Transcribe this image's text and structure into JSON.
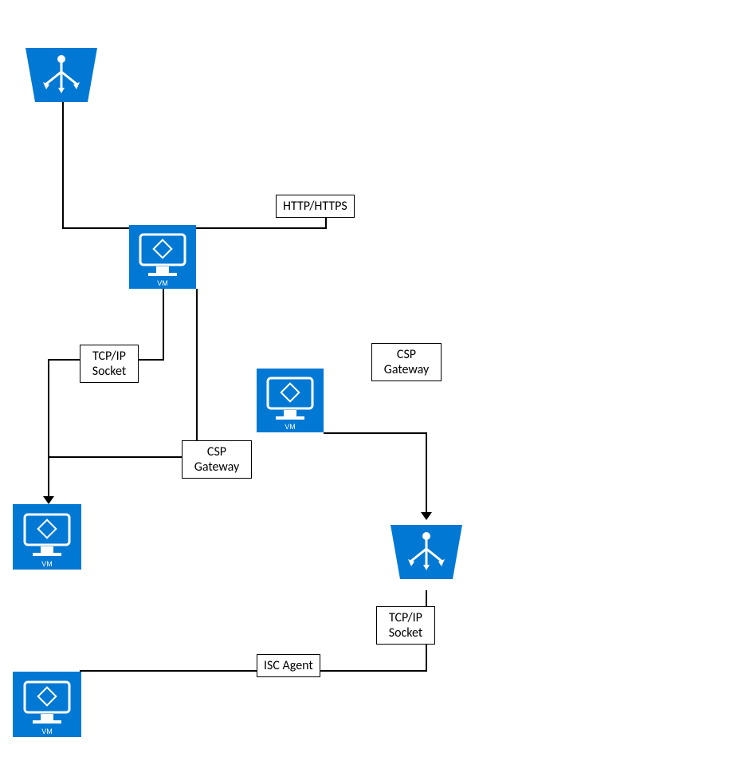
{
  "labels": {
    "http": "HTTP/HTTPS",
    "csp1": "CSP Gateway",
    "csp2": "CSP Gateway",
    "socket1": "TCP/IP Socket",
    "socket2": "TCP/IP Socket",
    "isc": "ISC Agent"
  },
  "nodes": {
    "lb1_caption": "",
    "lb2_caption": "",
    "vm_caption": "VM"
  },
  "colors": {
    "azure_blue": "#0078D4"
  }
}
